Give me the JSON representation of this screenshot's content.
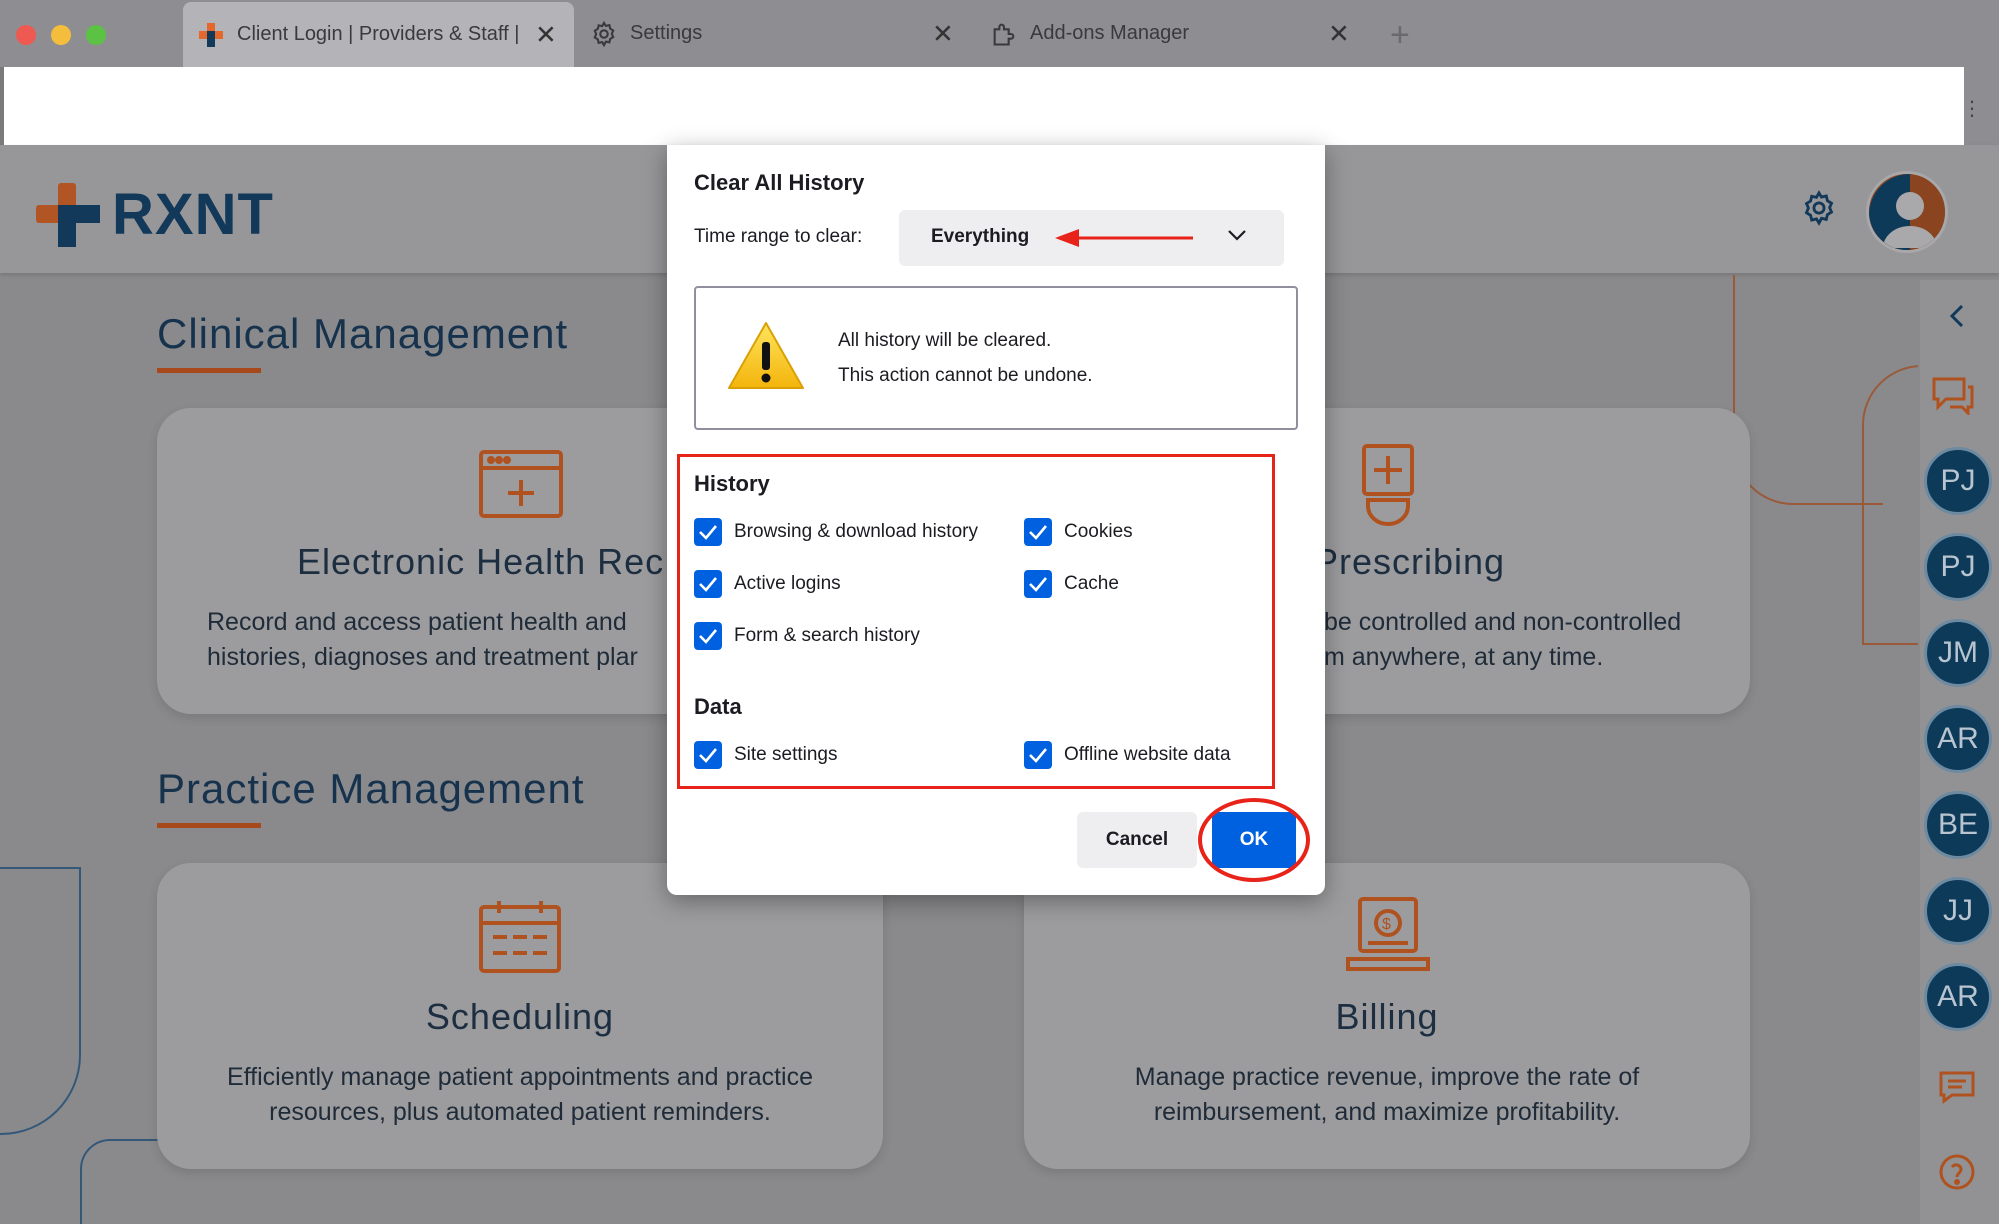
{
  "browser": {
    "tabs": [
      {
        "label": "Client Login | Providers & Staff |",
        "icon": "rxnt-favicon-icon",
        "active": true
      },
      {
        "label": "Settings",
        "icon": "gear-icon",
        "active": false
      },
      {
        "label": "Add-ons Manager",
        "icon": "puzzle-icon",
        "active": false
      }
    ],
    "close_glyph": "✕",
    "new_tab_glyph": "+"
  },
  "app": {
    "logo_text": "RXNT",
    "sections": {
      "clinical": "Clinical Management",
      "practice": "Practice Management"
    },
    "cards": {
      "ehr": {
        "title": "Electronic Health Rec",
        "desc1": "Record and access patient health and",
        "desc2": "histories, diagnoses and treatment plar"
      },
      "rx": {
        "title": "Prescribing",
        "desc1": "be controlled and non-controlled",
        "desc2": "m anywhere, at any time."
      },
      "scheduling": {
        "title": "Scheduling",
        "desc1": "Efficiently manage patient appointments and practice",
        "desc2": "resources, plus automated patient reminders."
      },
      "billing": {
        "title": "Billing",
        "desc1": "Manage practice revenue, improve the rate of",
        "desc2": "reimbursement, and maximize profitability."
      }
    },
    "rail_badges": [
      "PJ",
      "PJ",
      "JM",
      "AR",
      "BE",
      "JJ",
      "AR"
    ]
  },
  "dialog": {
    "title": "Clear All History",
    "range_label": "Time range to clear:",
    "range_value": "Everything",
    "warning_line1": "All history will be cleared.",
    "warning_line2": "This action cannot be undone.",
    "history_label": "History",
    "data_label": "Data",
    "checkboxes": {
      "browsing": "Browsing & download history",
      "cookies": "Cookies",
      "logins": "Active logins",
      "cache": "Cache",
      "forms": "Form & search history",
      "site_settings": "Site settings",
      "offline": "Offline website data"
    },
    "cancel_label": "Cancel",
    "ok_label": "OK"
  },
  "colors": {
    "accent_blue": "#0061e0",
    "annotation_red": "#e8231a",
    "brand_orange": "#e4682b",
    "brand_navy": "#12385a"
  }
}
